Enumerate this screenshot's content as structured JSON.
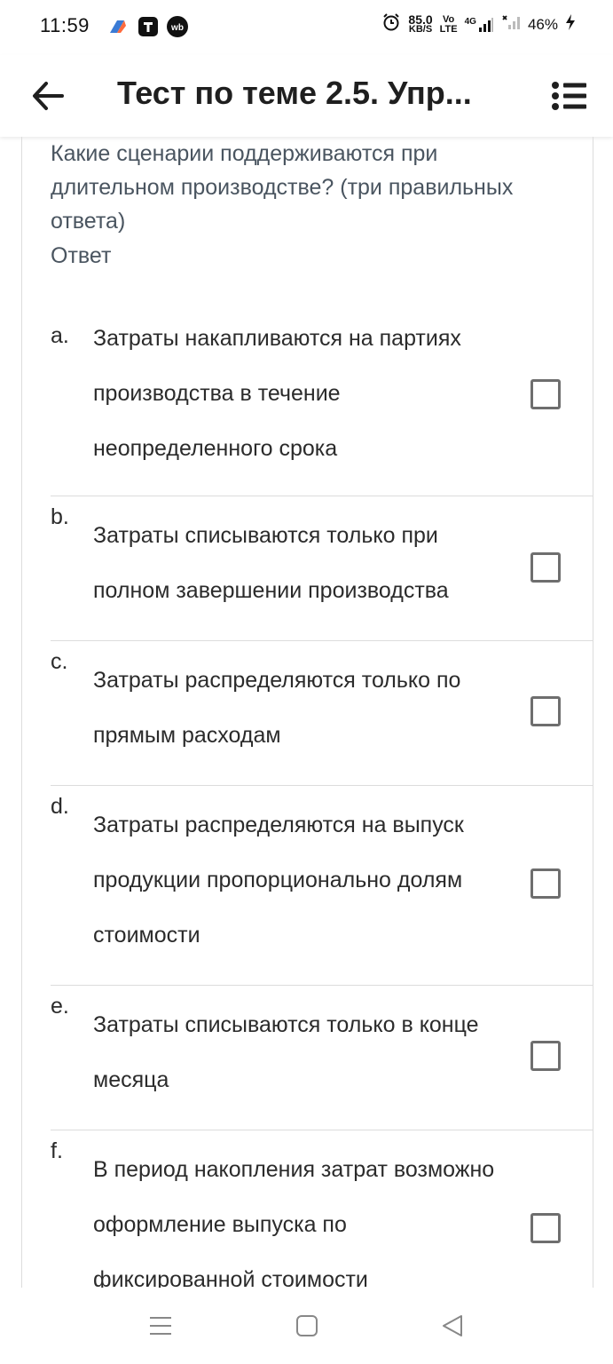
{
  "status": {
    "time": "11:59",
    "speed_value": "85.0",
    "speed_unit": "KB/S",
    "volte_top": "Vo",
    "volte_bottom": "LTE",
    "network": "4G",
    "battery": "46%"
  },
  "header": {
    "title": "Тест по теме 2.5. Упр..."
  },
  "question": {
    "text": "Какие сценарии поддерживаются при длительном производстве? (три правильных ответа)",
    "answer_label": "Ответ"
  },
  "options": [
    {
      "letter": "a.",
      "text": "Затраты накапливаются на партиях производства в течение неопределенного срока",
      "checked": false
    },
    {
      "letter": "b.",
      "text": "Затраты списываются только при полном завершении производства",
      "checked": false
    },
    {
      "letter": "c.",
      "text": "Затраты распределяются только по прямым расходам",
      "checked": false
    },
    {
      "letter": "d.",
      "text": "Затраты распределяются на выпуск продукции пропорционально долям стоимости",
      "checked": false
    },
    {
      "letter": "e.",
      "text": "Затраты списываются только в конце месяца",
      "checked": false
    },
    {
      "letter": "f.",
      "text": "В период накопления затрат возможно оформление выпуска по фиксированной стоимости",
      "checked": false
    }
  ]
}
